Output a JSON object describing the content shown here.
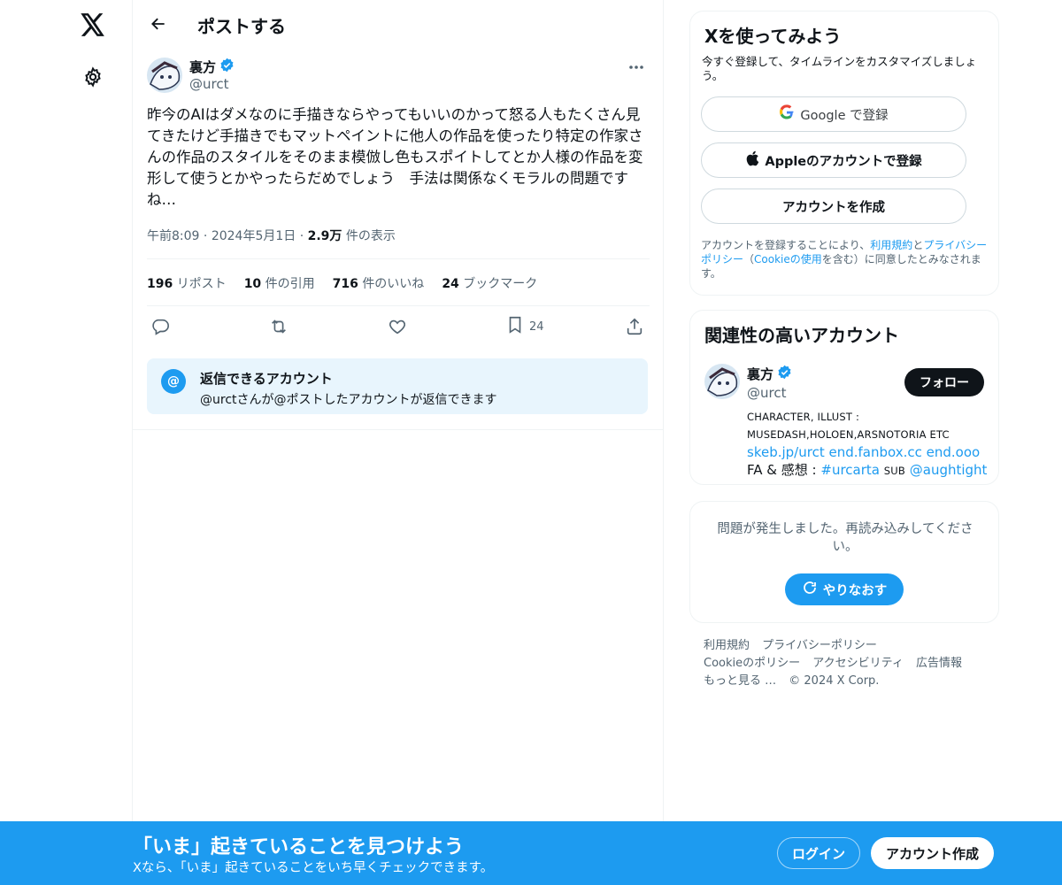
{
  "colors": {
    "accent": "#1d9bf0",
    "text": "#0f1419",
    "muted": "#536471",
    "border": "#eff3f4",
    "reply_bg": "#e8f5fd"
  },
  "leftnav": {
    "logo_icon": "x-logo-icon",
    "settings_icon": "gear-icon"
  },
  "header": {
    "title": "ポストする",
    "back_icon": "arrow-left-icon"
  },
  "post": {
    "author_name": "裏方",
    "author_handle": "@urct",
    "text": "昨今のAIはダメなのに手描きならやってもいいのかって怒る人もたくさん見てきたけど手描きでもマットペイントに他人の作品を使ったり特定の作家さんの作品のスタイルをそのまま模倣し色もスポイトしてとか人様の作品を変形して使うとかやったらだめでしょう　手法は関係なくモラルの問題ですね…",
    "time": "午前8:09",
    "date": "2024年5月1日",
    "views_count": "2.9万",
    "views_label": "件の表示",
    "stats": {
      "reposts_count": "196",
      "reposts_label": "リポスト",
      "quotes_count": "10",
      "quotes_label": "件の引用",
      "likes_count": "716",
      "likes_label": "件のいいね",
      "bookmarks_count": "24",
      "bookmarks_label": "ブックマーク"
    },
    "bookmark_action_count": "24"
  },
  "reply_restriction": {
    "title": "返信できるアカウント",
    "subtitle": "@urctさんが@ポストしたアカウントが返信できます",
    "icon_text": "@"
  },
  "signup_card": {
    "title": "Xを使ってみよう",
    "subtitle": "今すぐ登録して、タイムラインをカスタマイズしましょう。",
    "google_label": "Google で登録",
    "apple_label": "Appleのアカウントで登録",
    "create_label": "アカウントを作成",
    "terms_prefix": "アカウントを登録することにより、",
    "terms_link1": "利用規約",
    "terms_and": "と",
    "terms_link2": "プライバシーポリシー",
    "terms_mid": "（",
    "terms_link3": "Cookieの使用",
    "terms_suffix": "を含む）に同意したとみなされます。"
  },
  "related": {
    "title": "関連性の高いアカウント",
    "name": "裏方",
    "handle": "@urct",
    "follow_label": "フォロー",
    "bio_line1": "CHARACTER, ILLUST :",
    "bio_line2": "MUSEDASH,HOLOEN,ARSNOTORIA ETC",
    "bio_links": "skeb.jp/urct end.fanbox.cc end.ooo",
    "bio_fa": "FA",
    "bio_amp": "& 感想 :",
    "bio_tag": "#urcarta",
    "bio_sub": "SUB",
    "bio_mention": "@aughtight"
  },
  "error_card": {
    "message": "問題が発生しました。再読み込みしてください。",
    "retry_label": "やりなおす"
  },
  "footer": {
    "links": [
      "利用規約",
      "プライバシーポリシー",
      "Cookieのポリシー",
      "アクセシビリティ",
      "広告情報",
      "もっと見る …",
      "© 2024 X Corp."
    ]
  },
  "banner": {
    "title": "「いま」起きていることを見つけよう",
    "subtitle": "Xなら、「いま」起きていることをいち早くチェックできます。",
    "login_label": "ログイン",
    "signup_label": "アカウント作成"
  }
}
